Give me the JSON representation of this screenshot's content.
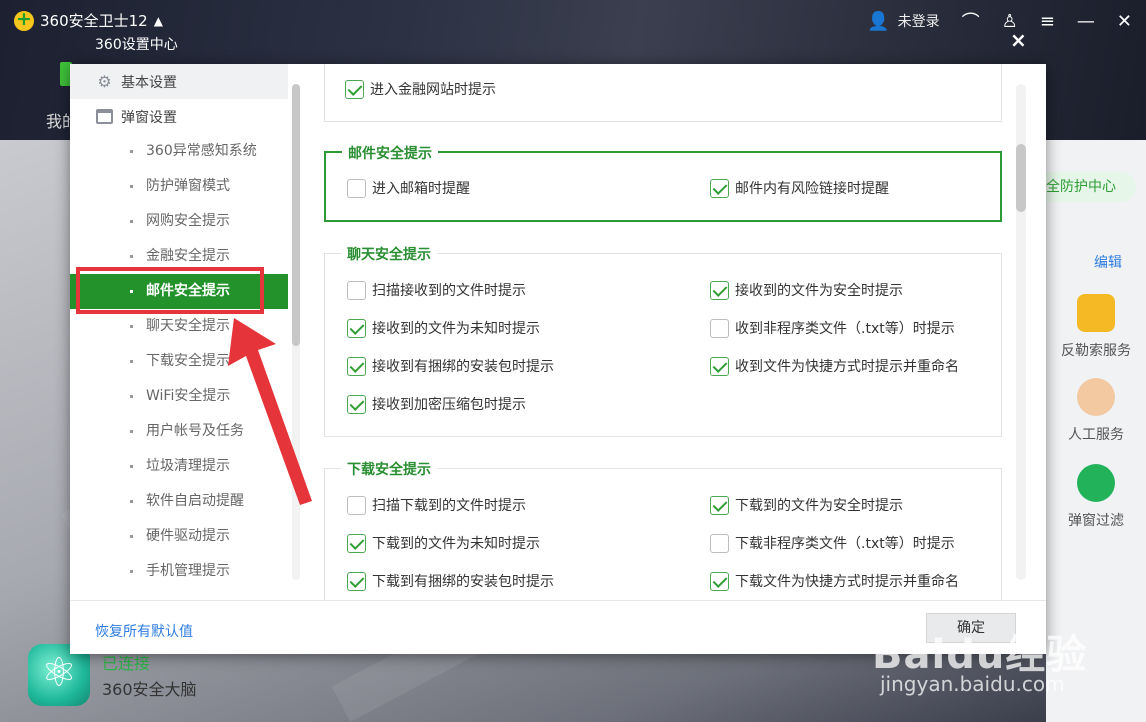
{
  "app": {
    "title": "360安全卫士12",
    "login": "未登录",
    "my_label": "我的",
    "protect_center": "全防护中心",
    "edit": "编辑",
    "services": [
      "反勒索服务",
      "人工服务",
      "弹窗过滤"
    ],
    "status_line1": "已连接",
    "status_line2": "360安全大脑",
    "watermark": "Baidu经验",
    "watermark_url": "jingyan.baidu.com"
  },
  "dialog": {
    "title": "360设置中心",
    "close": "×",
    "sidebar": {
      "groups": [
        {
          "label": "基本设置",
          "icon": "gear-icon"
        },
        {
          "label": "弹窗设置",
          "icon": "window-icon"
        }
      ],
      "items": [
        "360异常感知系统",
        "防护弹窗模式",
        "网购安全提示",
        "金融安全提示",
        "邮件安全提示",
        "聊天安全提示",
        "下载安全提示",
        "WiFi安全提示",
        "用户帐号及任务",
        "垃圾清理提示",
        "软件自启动提醒",
        "硬件驱动提示",
        "手机管理提示"
      ],
      "selected_index": 4
    },
    "sections": {
      "finance": {
        "options": [
          {
            "label": "进入金融网站时提示",
            "checked": true
          }
        ]
      },
      "mail": {
        "title": "邮件安全提示",
        "options": [
          {
            "label": "进入邮箱时提醒",
            "checked": false
          },
          {
            "label": "邮件内有风险链接时提醒",
            "checked": true
          }
        ]
      },
      "chat": {
        "title": "聊天安全提示",
        "options": [
          {
            "label": "扫描接收到的文件时提示",
            "checked": false
          },
          {
            "label": "接收到的文件为安全时提示",
            "checked": true
          },
          {
            "label": "接收到的文件为未知时提示",
            "checked": true
          },
          {
            "label": "收到非程序类文件（.txt等）时提示",
            "checked": false
          },
          {
            "label": "接收到有捆绑的安装包时提示",
            "checked": true
          },
          {
            "label": "收到文件为快捷方式时提示并重命名",
            "checked": true
          },
          {
            "label": "接收到加密压缩包时提示",
            "checked": true
          }
        ]
      },
      "download": {
        "title": "下载安全提示",
        "options": [
          {
            "label": "扫描下载到的文件时提示",
            "checked": false
          },
          {
            "label": "下载到的文件为安全时提示",
            "checked": true
          },
          {
            "label": "下载到的文件为未知时提示",
            "checked": true
          },
          {
            "label": "下载非程序类文件（.txt等）时提示",
            "checked": false
          },
          {
            "label": "下载到有捆绑的安装包时提示",
            "checked": true
          },
          {
            "label": "下载文件为快捷方式时提示并重命名",
            "checked": true
          }
        ]
      }
    },
    "footer": {
      "restore": "恢复所有默认值",
      "confirm": "确定"
    }
  },
  "colors": {
    "accent_green": "#23922b",
    "annotation_red": "#e5353a",
    "link_blue": "#2f7de0"
  }
}
